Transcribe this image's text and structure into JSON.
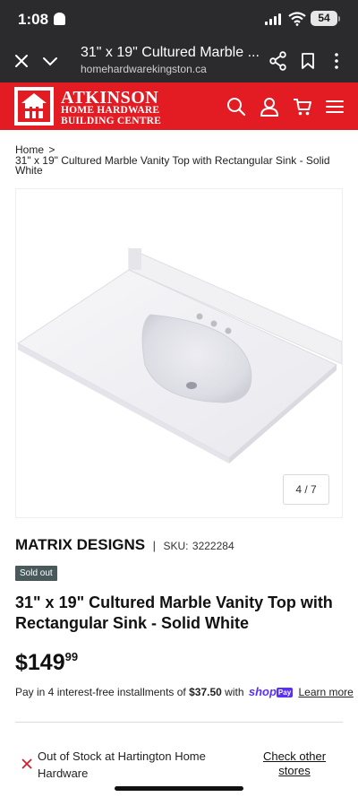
{
  "status_bar": {
    "time": "1:08",
    "battery": "54"
  },
  "browser": {
    "page_title": "31\" x 19\" Cultured Marble ...",
    "url": "homehardwarekingston.ca"
  },
  "site": {
    "brand_name": "ATKINSON",
    "brand_line1": "HOME HARDWARE",
    "brand_line2": "BUILDING CENTRE",
    "accent_color": "#e31b23"
  },
  "breadcrumb": {
    "home": "Home",
    "separator": ">",
    "current": "31\" x 19\" Cultured Marble Vanity Top with Rectangular Sink - Solid White"
  },
  "gallery": {
    "counter": "4 / 7"
  },
  "product": {
    "brand": "MATRIX DESIGNS",
    "divider": "|",
    "sku_label": "SKU:",
    "sku": "3222284",
    "badge": "Sold out",
    "title": "31\" x 19\" Cultured Marble Vanity Top with Rectangular Sink - Solid White",
    "price_dollars": "$149",
    "price_cents": "99"
  },
  "installments": {
    "prefix": "Pay in 4 interest-free installments of",
    "amount": "$37.50",
    "with": "with",
    "shop": "shop",
    "pay": "Pay",
    "learn_more": "Learn more"
  },
  "stock": {
    "message": "Out of Stock at Hartington Home Hardware",
    "check_other": "Check other stores"
  }
}
